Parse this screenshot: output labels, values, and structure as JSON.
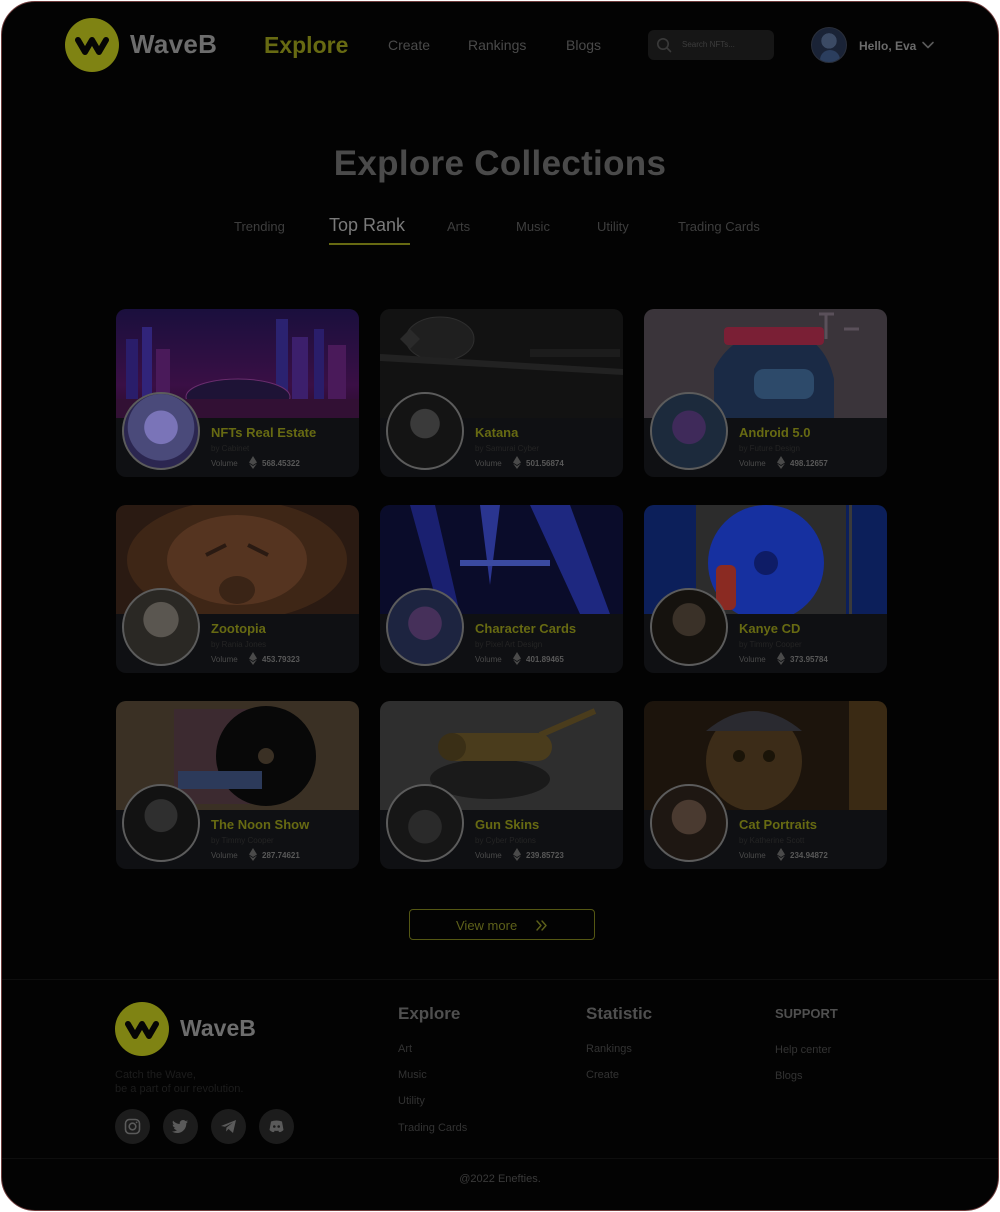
{
  "brand": {
    "name": "WaveB",
    "color": "#7f8313",
    "icon": "wave-logo-icon"
  },
  "nav": {
    "active": "Explore",
    "items": [
      "Create",
      "Rankings",
      "Blogs"
    ]
  },
  "search": {
    "placeholder": "Search NFTs..."
  },
  "user": {
    "greeting": "Hello, Eva"
  },
  "page": {
    "title": "Explore Collections"
  },
  "tabs": [
    {
      "label": "Trending"
    },
    {
      "label": "Top Rank",
      "active": true
    },
    {
      "label": "Arts"
    },
    {
      "label": "Music"
    },
    {
      "label": "Utility"
    },
    {
      "label": "Trading Cards"
    }
  ],
  "collections": [
    {
      "name": "NFTs Real Estate",
      "byline": "by Cabinet",
      "volume_label": "Volume",
      "volume": "568.45322"
    },
    {
      "name": "Katana",
      "byline": "by Samurai Cyber",
      "volume_label": "Volume",
      "volume": "501.56874"
    },
    {
      "name": "Android 5.0",
      "byline": "by Future Design",
      "volume_label": "Volume",
      "volume": "498.12657"
    },
    {
      "name": "Zootopia",
      "byline": "by Rania Jones",
      "volume_label": "Volume",
      "volume": "453.79323"
    },
    {
      "name": "Character Cards",
      "byline": "by Pixel Art Design",
      "volume_label": "Volume",
      "volume": "401.89465"
    },
    {
      "name": "Kanye CD",
      "byline": "by Timmy Cooper",
      "volume_label": "Volume",
      "volume": "373.95784"
    },
    {
      "name": "The Noon Show",
      "byline": "by Timmy Cooper",
      "volume_label": "Volume",
      "volume": "287.74621"
    },
    {
      "name": "Gun Skins",
      "byline": "by Cyber Potions",
      "volume_label": "Volume",
      "volume": "239.85723"
    },
    {
      "name": "Cat Portraits",
      "byline": "by Katherine Scott",
      "volume_label": "Volume",
      "volume": "234.94872"
    }
  ],
  "view_more": {
    "label": "View more"
  },
  "footer": {
    "brand": "WaveB",
    "tagline_1": "Catch the Wave,",
    "tagline_2": "be a part of our revolution.",
    "social": [
      "instagram-icon",
      "twitter-icon",
      "telegram-icon",
      "discord-icon"
    ],
    "explore": {
      "title": "Explore",
      "links": [
        "Art",
        "Music",
        "Utility",
        "Trading Cards"
      ]
    },
    "statistic": {
      "title": "Statistic",
      "links": [
        "Rankings",
        "Create"
      ]
    },
    "support": {
      "title": "SUPPORT",
      "links": [
        "Help center",
        "Blogs"
      ]
    },
    "copyright": "@2022 Enefties."
  }
}
